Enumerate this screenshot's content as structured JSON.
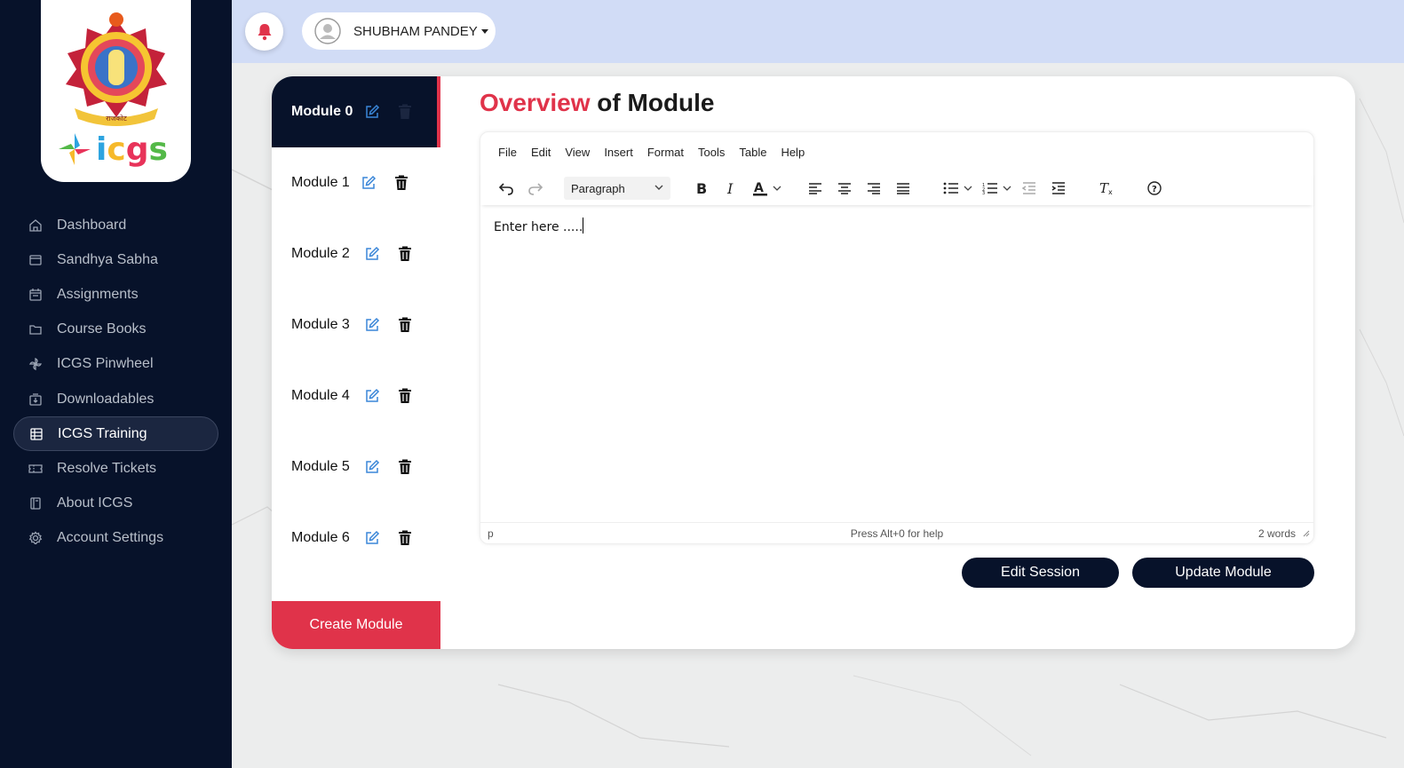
{
  "brand": {
    "logo_text": "icgs",
    "seal_text": "राजकोट"
  },
  "sidebar": {
    "items": [
      {
        "label": "Dashboard",
        "icon": "home-icon"
      },
      {
        "label": "Sandhya Sabha",
        "icon": "window-icon"
      },
      {
        "label": "Assignments",
        "icon": "calendar-icon"
      },
      {
        "label": "Course Books",
        "icon": "folder-icon"
      },
      {
        "label": "ICGS Pinwheel",
        "icon": "pinwheel-icon"
      },
      {
        "label": "Downloadables",
        "icon": "download-box-icon"
      },
      {
        "label": "ICGS Training",
        "icon": "grid-icon",
        "active": true
      },
      {
        "label": "Resolve Tickets",
        "icon": "ticket-icon"
      },
      {
        "label": "About ICGS",
        "icon": "book-icon"
      },
      {
        "label": "Account Settings",
        "icon": "gear-icon"
      }
    ]
  },
  "header": {
    "user_name": "SHUBHAM PANDEY"
  },
  "modules": {
    "items": [
      "Module 0",
      "Module 1",
      "Module 2",
      "Module 3",
      "Module 4",
      "Module 5",
      "Module 6"
    ],
    "active_index": 0,
    "create_label": "Create Module"
  },
  "main": {
    "title_highlight": "Overview",
    "title_rest": " of Module",
    "editor": {
      "menus": [
        "File",
        "Edit",
        "View",
        "Insert",
        "Format",
        "Tools",
        "Table",
        "Help"
      ],
      "block_format": "Paragraph",
      "content": "Enter here .....",
      "status_path": "p",
      "status_help": "Press Alt+0 for help",
      "word_count": "2 words"
    },
    "edit_session_label": "Edit Session",
    "update_module_label": "Update Module"
  },
  "colors": {
    "navy": "#07122a",
    "accent_red": "#e0334a",
    "topbar": "#d1dcf6",
    "link_blue": "#3a86d8"
  }
}
